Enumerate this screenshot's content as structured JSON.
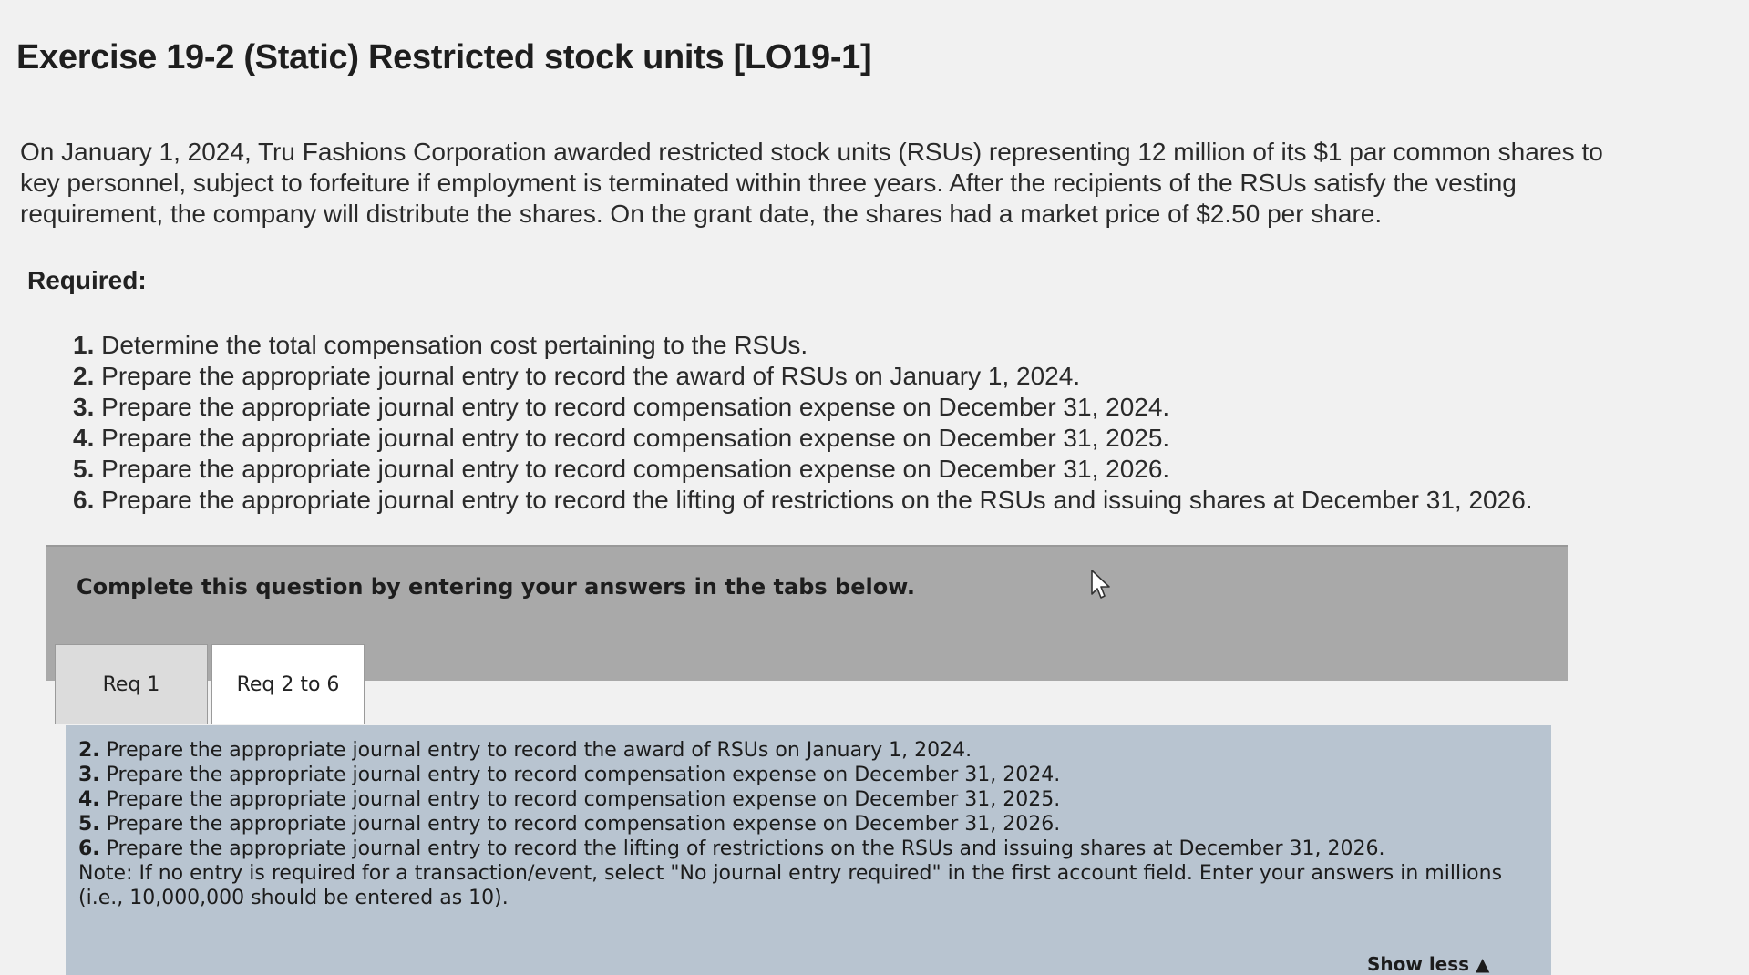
{
  "exercise": {
    "title": "Exercise 19-2 (Static) Restricted stock units [LO19-1]",
    "intro": "On January 1, 2024, Tru Fashions Corporation awarded restricted stock units (RSUs) representing 12 million of its $1 par common shares to key personnel, subject to forfeiture if employment is terminated within three years. After the recipients of the RSUs satisfy the vesting requirement, the company will distribute the shares. On the grant date, the shares had a market price of $2.50 per share.",
    "required_label": "Required:",
    "requirements": [
      {
        "num": "1.",
        "text": "Determine the total compensation cost pertaining to the RSUs."
      },
      {
        "num": "2.",
        "text": "Prepare the appropriate journal entry to record the award of RSUs on January 1, 2024."
      },
      {
        "num": "3.",
        "text": "Prepare the appropriate journal entry to record compensation expense on December 31, 2024."
      },
      {
        "num": "4.",
        "text": "Prepare the appropriate journal entry to record compensation expense on December 31, 2025."
      },
      {
        "num": "5.",
        "text": "Prepare the appropriate journal entry to record compensation expense on December 31, 2026."
      },
      {
        "num": "6.",
        "text": "Prepare the appropriate journal entry to record the lifting of restrictions on the RSUs and issuing shares at December 31, 2026."
      }
    ]
  },
  "banner": {
    "text": "Complete this question by entering your answers in the tabs below."
  },
  "tabs": [
    {
      "label": "Req 1",
      "active": false
    },
    {
      "label": "Req 2 to 6",
      "active": true
    }
  ],
  "panel": {
    "lines": [
      {
        "num": "2.",
        "text": "Prepare the appropriate journal entry to record the award of RSUs on January 1, 2024."
      },
      {
        "num": "3.",
        "text": "Prepare the appropriate journal entry to record compensation expense on December 31, 2024."
      },
      {
        "num": "4.",
        "text": "Prepare the appropriate journal entry to record compensation expense on December 31, 2025."
      },
      {
        "num": "5.",
        "text": "Prepare the appropriate journal entry to record compensation expense on December 31, 2026."
      },
      {
        "num": "6.",
        "text": "Prepare the appropriate journal entry to record the lifting of restrictions on the RSUs and issuing shares at December 31, 2026."
      }
    ],
    "note": "Note: If no entry is required for a transaction/event, select \"No journal entry required\" in the first account field. Enter your answers in millions (i.e., 10,000,000 should be entered as 10).",
    "show_less": "Show less ▲"
  }
}
